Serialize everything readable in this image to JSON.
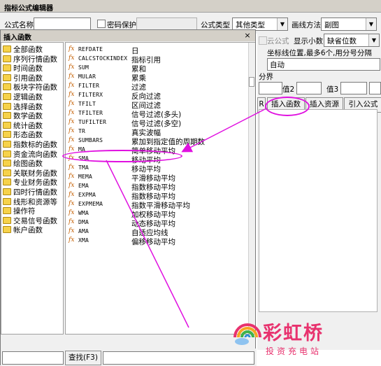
{
  "editor": {
    "title": "指标公式编辑器",
    "formula_name_label": "公式名称",
    "password_label": "密码保护",
    "formula_type_label": "公式类型",
    "formula_type_value": "其他类型",
    "draw_method_label": "画线方法",
    "draw_method_value": "副图",
    "cloud_formula_label": "云公式",
    "show_decimals_label": "显示小数",
    "show_decimals_value": "缺省位数",
    "coord_hint": "坐标线位置,最多6个,用分号分隔",
    "auto_value": "自动",
    "boundary_label": "分界",
    "value2_label": "值2",
    "value3_label": "值3",
    "partial_button": "R",
    "insert_function_button": "插入函数",
    "insert_resource_button": "插入资源",
    "import_formula_button": "引入公式"
  },
  "dialog": {
    "title": "插入函数",
    "close": "×",
    "categories": [
      "全部函数",
      "序列行情函数",
      "时间函数",
      "引用函数",
      "板块字符函数",
      "逻辑函数",
      "选择函数",
      "数学函数",
      "统计函数",
      "形态函数",
      "指数标的函数",
      "资金流向函数",
      "绘图函数",
      "关联财务函数",
      "专业财务函数",
      "四时行情函数",
      "线形和资源等",
      "操作符",
      "交易信号函数",
      "帐户函数"
    ],
    "functions": [
      {
        "name": "REFDATE",
        "desc": "日"
      },
      {
        "name": "CALCSTOCKINDEX",
        "desc": "指标引用"
      },
      {
        "name": "SUM",
        "desc": "累和"
      },
      {
        "name": "MULAR",
        "desc": "累乘"
      },
      {
        "name": "FILTER",
        "desc": "过滤"
      },
      {
        "name": "FILTERX",
        "desc": "反向过滤"
      },
      {
        "name": "TFILT",
        "desc": "区间过滤"
      },
      {
        "name": "TFILTER",
        "desc": "信号过滤(多头)"
      },
      {
        "name": "TUFILTER",
        "desc": "信号过滤(多空)"
      },
      {
        "name": "TR",
        "desc": "真实波幅"
      },
      {
        "name": "SUMBARS",
        "desc": "累加到指定值的周期数"
      },
      {
        "name": "MA",
        "desc": "简单移动平均"
      },
      {
        "name": "SMA",
        "desc": "移动平均"
      },
      {
        "name": "TMA",
        "desc": "移动平均"
      },
      {
        "name": "MEMA",
        "desc": "平滑移动平均"
      },
      {
        "name": "EMA",
        "desc": "指数移动平均"
      },
      {
        "name": "EXPMA",
        "desc": "指数移动平均"
      },
      {
        "name": "EXPMEMA",
        "desc": "指数平滑移动平均"
      },
      {
        "name": "WMA",
        "desc": "加权移动平均"
      },
      {
        "name": "DMA",
        "desc": "动态移动平均"
      },
      {
        "name": "AMA",
        "desc": "自适应均线"
      },
      {
        "name": "XMA",
        "desc": "偏移移动平均"
      }
    ],
    "find_button": "查找(F3)"
  },
  "watermark": {
    "brand": "彩虹桥",
    "sub": "投资充电站"
  },
  "colors": {
    "annotation": "#e010e0",
    "brand": "#e8326e",
    "fx_icon": "#c45e00"
  }
}
